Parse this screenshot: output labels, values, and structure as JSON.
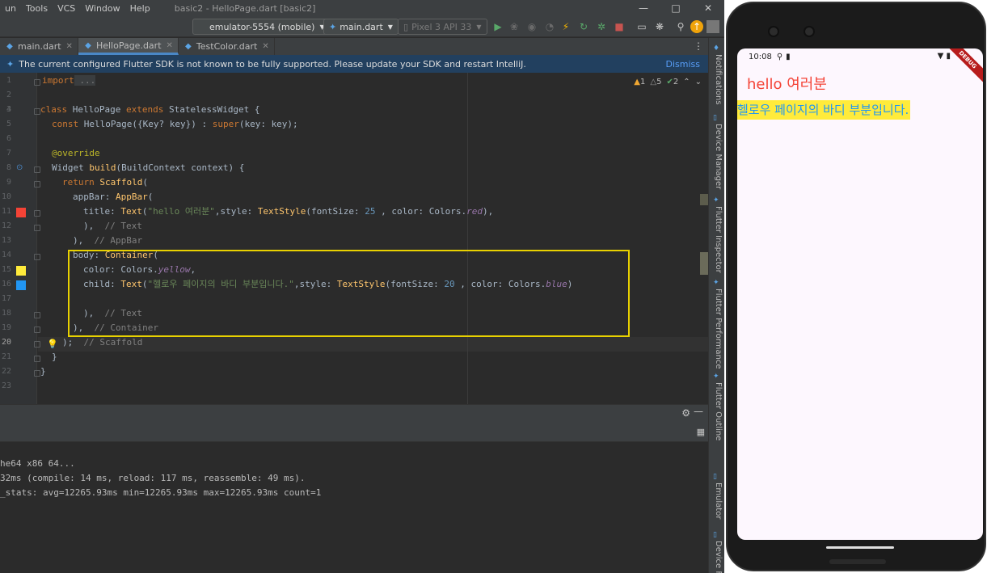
{
  "menubar": {
    "items": [
      "un",
      "Tools",
      "VCS",
      "Window",
      "Help"
    ],
    "title": "basic2 - HelloPage.dart [basic2]"
  },
  "toolbar": {
    "device": "emulator-5554 (mobile)",
    "run_config": "main.dart",
    "avd": "Pixel 3 API 33"
  },
  "tabs": [
    {
      "label": "main.dart",
      "active": false
    },
    {
      "label": "HelloPage.dart",
      "active": true
    },
    {
      "label": "TestColor.dart",
      "active": false
    }
  ],
  "banner": {
    "message": "The current configured Flutter SDK is not known to be fully supported. Please update your SDK and restart IntelliJ.",
    "dismiss": "Dismiss"
  },
  "inspections": {
    "warnings": "1",
    "weak_warnings": "5",
    "ok": "2"
  },
  "editor": {
    "line_numbers": [
      "1",
      "2",
      "3",
      "4",
      "5",
      "6",
      "7",
      "8",
      "9",
      "10",
      "11",
      "12",
      "13",
      "14",
      "15",
      "16",
      "17",
      "18",
      "19",
      "20",
      "21",
      "22",
      "23"
    ],
    "current_line": "20",
    "lines": {
      "l1_kw": "import",
      "l1_fold": " ...",
      "l4_kw": "class",
      "l4_a": " HelloPage ",
      "l4_kw2": "extends",
      "l4_b": " StatelessWidget {",
      "l5_kw": "const",
      "l5_a": " HelloPage({Key? key}) : ",
      "l5_kw2": "super",
      "l5_b": "(key: key);",
      "l7_ann": "@override",
      "l8_a": "Widget ",
      "l8_fn": "build",
      "l8_b": "(BuildContext context) {",
      "l9_kw": "return",
      "l9_fn": " Scaffold",
      "l9_b": "(",
      "l10_a": "appBar: ",
      "l10_fn": "AppBar",
      "l10_b": "(",
      "l11_a": "title: ",
      "l11_fn": "Text",
      "l11_b": "(",
      "l11_str": "\"hello 여러분\"",
      "l11_c": ",style: ",
      "l11_fn2": "TextStyle",
      "l11_d": "(fontSize: ",
      "l11_num": "25",
      "l11_e": " , color: Colors.",
      "l11_it": "red",
      "l11_f": "),",
      "l12_a": "),",
      "l12_cmt": "  // Text",
      "l13_a": "),",
      "l13_cmt": "  // AppBar",
      "l14_a": "body: ",
      "l14_fn": "Container",
      "l14_b": "(",
      "l15_a": "color: Colors.",
      "l15_it": "yellow",
      "l15_b": ",",
      "l16_a": "child: ",
      "l16_fn": "Text",
      "l16_b": "(",
      "l16_str": "\"헬로우 페이지의 바디 부분입니다.\"",
      "l16_c": ",style: ",
      "l16_fn2": "TextStyle",
      "l16_d": "(fontSize: ",
      "l16_num": "20",
      "l16_e": " , color: Colors.",
      "l16_it": "blue",
      "l16_f": ")",
      "l18_a": "),",
      "l18_cmt": "  // Text",
      "l19_a": "),",
      "l19_cmt": "  // Container",
      "l20_a": ");",
      "l20_cmt": "  // Scaffold",
      "l21_a": "}",
      "l22_a": "}"
    }
  },
  "console": {
    "lines": [
      "he64 x86 64...",
      "32ms (compile: 14 ms, reload: 117 ms, reassemble: 49 ms).",
      "_stats: avg=12265.93ms min=12265.93ms max=12265.93ms count=1"
    ]
  },
  "right_sidebar": {
    "tabs": [
      "Notifications",
      "Device Manager",
      "Flutter Inspector",
      "Flutter Performance",
      "Flutter Outline",
      "Emulator",
      "Device Fi"
    ]
  },
  "phone": {
    "time": "10:08",
    "debug_banner": "DEBUG",
    "app_title": "hello 여러분",
    "body_text": "헬로우 페이지의 바디 부분입니다.",
    "title_color": "#f44336",
    "body_color": "#2196f3",
    "body_bg": "#ffeb3b"
  },
  "colors": {
    "ide_bg": "#2b2b2b",
    "highlight_box": "#e8d100",
    "banner_bg": "#22405f",
    "active_tab_underline": "#4a88c7"
  }
}
